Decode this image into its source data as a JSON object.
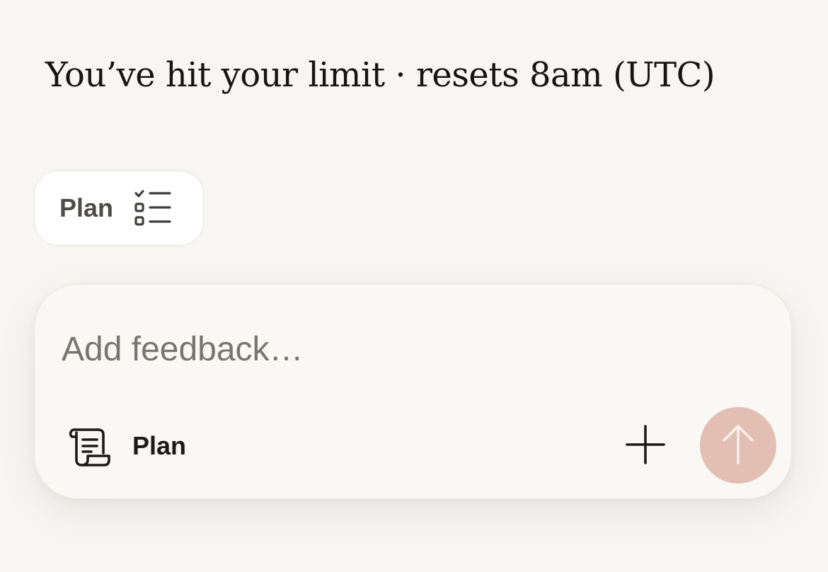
{
  "status": {
    "limit_message": "You’ve hit your limit · resets 8am (UTC)"
  },
  "plan_chip": {
    "label": "Plan",
    "icon": "checklist-icon"
  },
  "composer": {
    "placeholder": "Add feedback…",
    "value": "",
    "mode": {
      "label": "Plan",
      "icon": "scroll-icon"
    },
    "add_icon": "plus-icon",
    "send_icon": "arrow-up-icon"
  },
  "colors": {
    "background": "#f7f6f2",
    "send_button": "#e2bfb2",
    "text_primary": "#161513",
    "placeholder": "#787570"
  }
}
